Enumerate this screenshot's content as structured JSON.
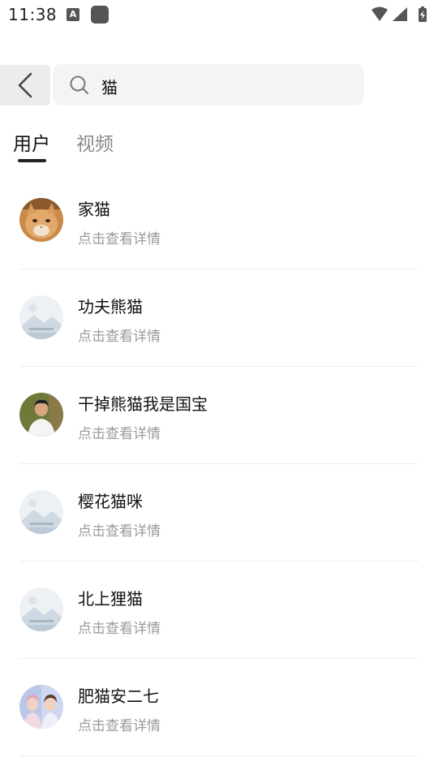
{
  "status": {
    "time": "11:38"
  },
  "search": {
    "query": "猫"
  },
  "tabs": [
    "用户",
    "视频"
  ],
  "users": [
    {
      "name": "家猫",
      "subtitle": "点击查看详情",
      "avatar": "cat-photo"
    },
    {
      "name": "功夫熊猫",
      "subtitle": "点击查看详情",
      "avatar": "placeholder-image"
    },
    {
      "name": "干掉熊猫我是国宝",
      "subtitle": "点击查看详情",
      "avatar": "person-photo"
    },
    {
      "name": "樱花猫咪",
      "subtitle": "点击查看详情",
      "avatar": "placeholder-image"
    },
    {
      "name": "北上狸猫",
      "subtitle": "点击查看详情",
      "avatar": "placeholder-image"
    },
    {
      "name": "肥猫安二七",
      "subtitle": "点击查看详情",
      "avatar": "two-people-photo"
    }
  ]
}
